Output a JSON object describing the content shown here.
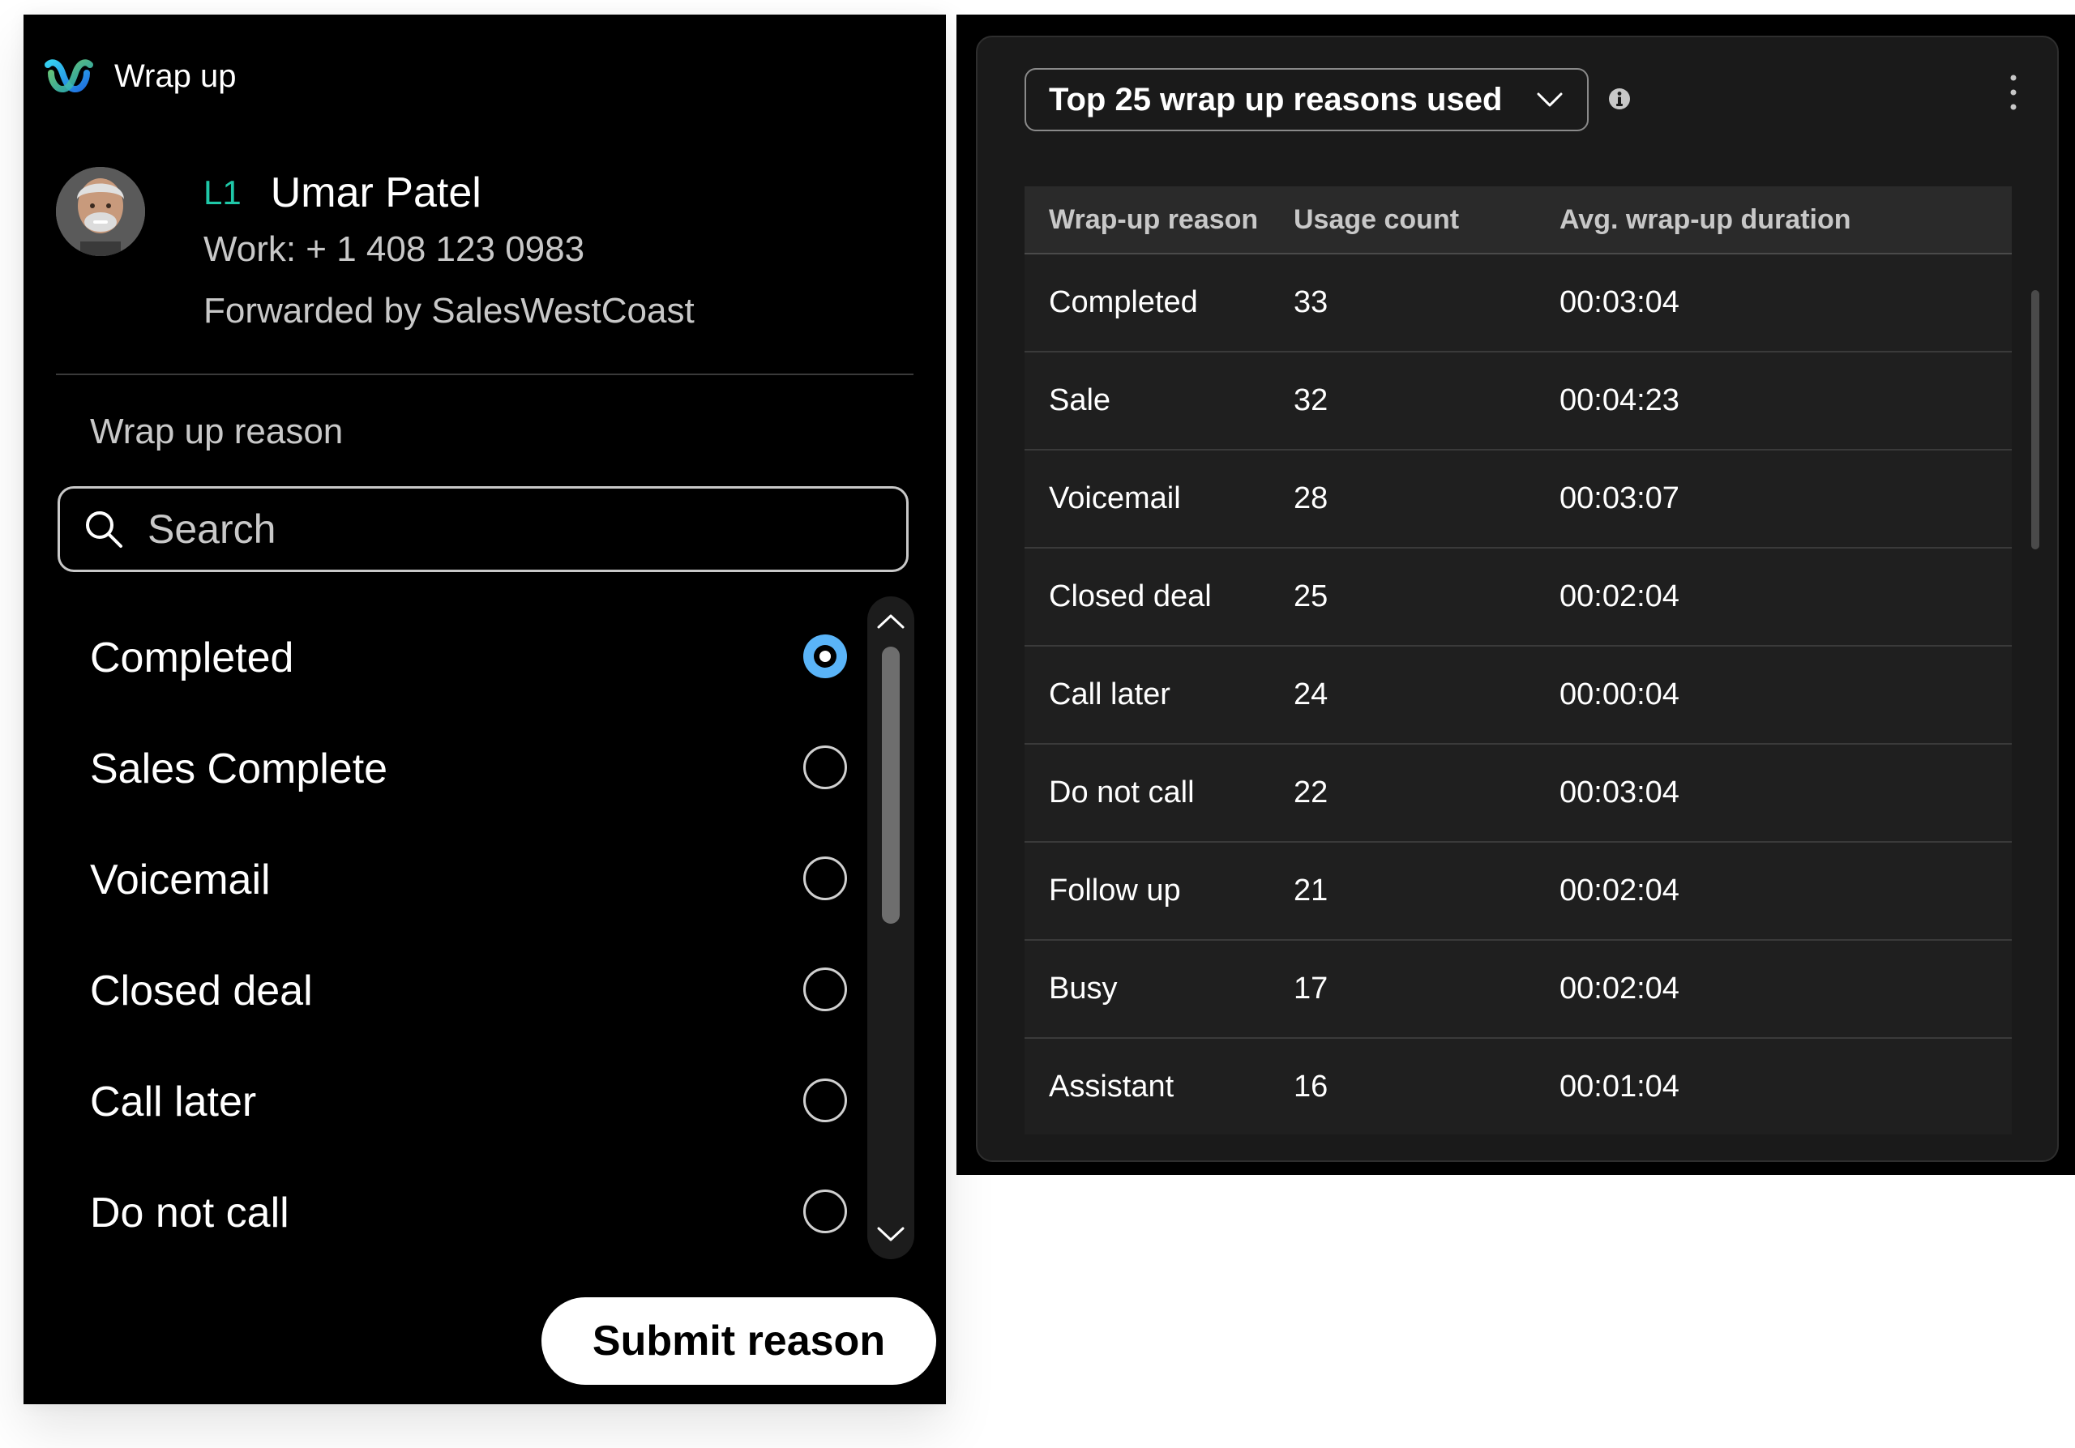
{
  "wrap_up": {
    "title": "Wrap up",
    "contact": {
      "level": "L1",
      "name": "Umar Patel",
      "work_phone": "Work: + 1 408 123 0983",
      "forwarded_by": "Forwarded by SalesWestCoast"
    },
    "section_label": "Wrap up reason",
    "search": {
      "placeholder": "Search",
      "value": ""
    },
    "reasons": [
      {
        "label": "Completed",
        "selected": true
      },
      {
        "label": "Sales Complete",
        "selected": false
      },
      {
        "label": "Voicemail",
        "selected": false
      },
      {
        "label": "Closed deal",
        "selected": false
      },
      {
        "label": "Call later",
        "selected": false
      },
      {
        "label": "Do not call",
        "selected": false
      }
    ],
    "submit_label": "Submit reason"
  },
  "report": {
    "dropdown_label": "Top 25 wrap up reasons used",
    "columns": [
      "Wrap-up reason",
      "Usage count",
      "Avg. wrap-up duration"
    ],
    "rows": [
      {
        "reason": "Completed",
        "count": "33",
        "avg": "00:03:04"
      },
      {
        "reason": "Sale",
        "count": "32",
        "avg": "00:04:23"
      },
      {
        "reason": "Voicemail",
        "count": "28",
        "avg": "00:03:07"
      },
      {
        "reason": "Closed deal",
        "count": "25",
        "avg": "00:02:04"
      },
      {
        "reason": "Call later",
        "count": "24",
        "avg": "00:00:04"
      },
      {
        "reason": "Do not call",
        "count": "22",
        "avg": "00:03:04"
      },
      {
        "reason": "Follow up",
        "count": "21",
        "avg": "00:02:04"
      },
      {
        "reason": "Busy",
        "count": "17",
        "avg": "00:02:04"
      },
      {
        "reason": "Assistant",
        "count": "16",
        "avg": "00:01:04"
      }
    ]
  },
  "icons": {
    "app_logo": "webex-logo-icon",
    "search": "search-icon",
    "selected_radio": "radio-checked-icon",
    "dropdown": "chevron-down-icon",
    "info": "info-icon",
    "more": "more-vertical-icon"
  },
  "colors": {
    "level_badge": "#1fc8a8",
    "radio_selected": "#5ab4f8",
    "panel_background": "#000000",
    "widget_background": "#1a1a1a"
  }
}
